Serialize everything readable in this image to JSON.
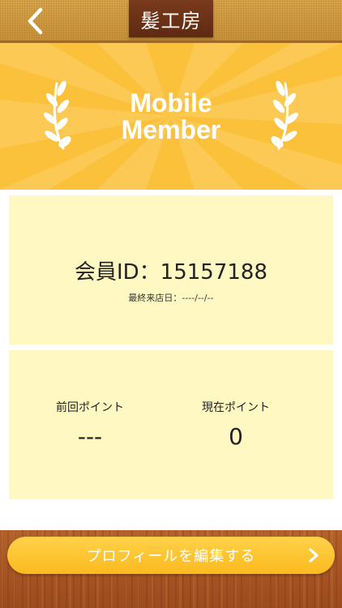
{
  "header": {
    "title": "髪工房",
    "back_icon": "chevron-left-icon"
  },
  "banner": {
    "line1": "Mobile",
    "line2": "Member",
    "left_icon": "laurel-left-icon",
    "right_icon": "laurel-right-icon",
    "colors": {
      "background": "#fcc13a",
      "text": "#ffffff"
    }
  },
  "member": {
    "id_label": "会員ID：",
    "id_value": "15157188",
    "last_visit_label": "最終来店日：",
    "last_visit_value": "----/--/--"
  },
  "points": {
    "previous_label": "前回ポイント",
    "previous_value": "---",
    "current_label": "現在ポイント",
    "current_value": "0"
  },
  "footer": {
    "edit_profile_label": "プロフィールを編集する",
    "chevron_icon": "chevron-right-icon",
    "colors": {
      "button": "#fbb91e"
    }
  }
}
